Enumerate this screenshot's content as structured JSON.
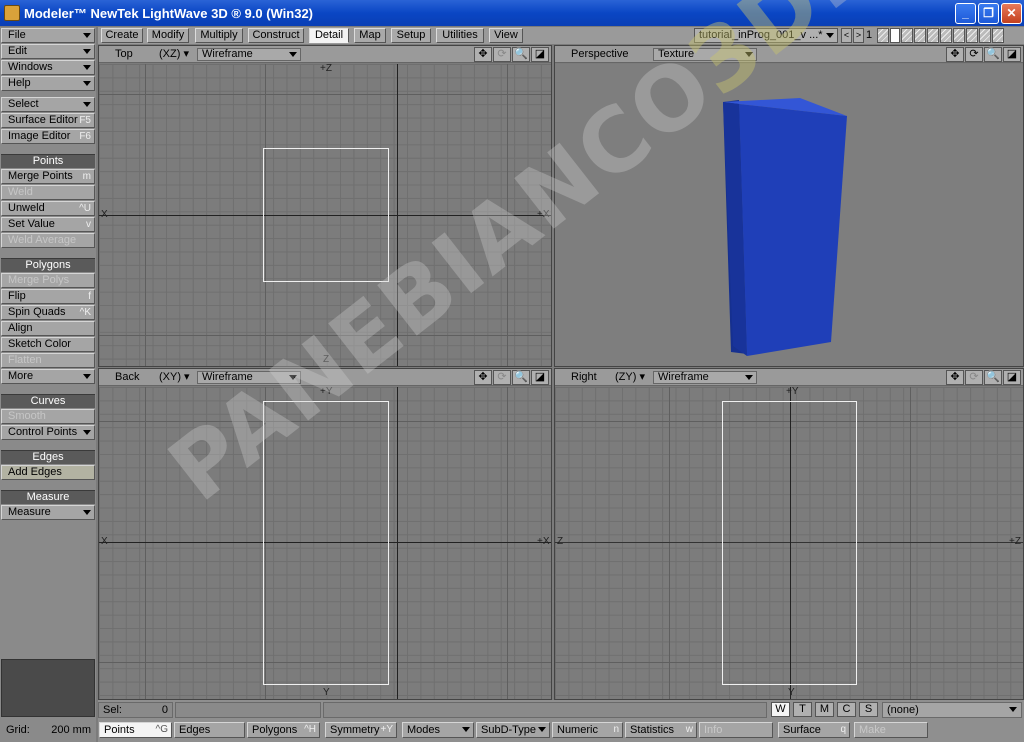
{
  "window": {
    "title": "Modeler™ NewTek LightWave 3D ® 9.0 (Win32)",
    "minimize": "_",
    "maximize": "❐",
    "close": "✕"
  },
  "sidebar": {
    "menus": [
      {
        "label": "File"
      },
      {
        "label": "Edit"
      },
      {
        "label": "Windows"
      },
      {
        "label": "Help"
      }
    ],
    "select": "Select",
    "surface_editor": {
      "label": "Surface Editor",
      "shortcut": "F5"
    },
    "image_editor": {
      "label": "Image Editor",
      "shortcut": "F6"
    },
    "points_header": "Points",
    "points_items": [
      {
        "label": "Merge Points",
        "shortcut": "m"
      },
      {
        "label": "Weld",
        "shortcut": ""
      },
      {
        "label": "Unweld",
        "shortcut": "^U"
      },
      {
        "label": "Set Value",
        "shortcut": "v"
      },
      {
        "label": "Weld Average",
        "shortcut": ""
      }
    ],
    "polygons_header": "Polygons",
    "polygons_items": [
      {
        "label": "Merge Polys",
        "shortcut": ""
      },
      {
        "label": "Flip",
        "shortcut": "f"
      },
      {
        "label": "Spin Quads",
        "shortcut": "^K"
      },
      {
        "label": "Align",
        "shortcut": ""
      },
      {
        "label": "Sketch Color",
        "shortcut": ""
      },
      {
        "label": "Flatten",
        "shortcut": ""
      }
    ],
    "more": "More",
    "curves_header": "Curves",
    "smooth": "Smooth",
    "control_points": "Control Points",
    "edges_header": "Edges",
    "add_edges": "Add Edges",
    "measure_header": "Measure",
    "measure": "Measure",
    "grid_label": "Grid:",
    "grid_value": "200 mm"
  },
  "tabs": [
    "Create",
    "Modify",
    "Multiply",
    "Construct",
    "Detail",
    "Map",
    "Setup",
    "Utilities",
    "View"
  ],
  "active_tab": "Detail",
  "layers": {
    "object": "tutorial_inProg_001_v ...*",
    "prev": "<",
    "next": ">",
    "number": "1"
  },
  "viewports": {
    "top": {
      "view": "Top",
      "axes": "(XZ)",
      "mode": "Wireframe",
      "label_top": "+Z",
      "label_bottom": "Z",
      "label_left": "X",
      "label_right": "+X"
    },
    "perspective": {
      "view": "Perspective",
      "mode": "Texture"
    },
    "back": {
      "view": "Back",
      "axes": "(XY)",
      "mode": "Wireframe",
      "label_top": "+Y",
      "label_bottom": "Y",
      "label_left": "X",
      "label_right": "+X"
    },
    "right": {
      "view": "Right",
      "axes": "(ZY)",
      "mode": "Wireframe",
      "label_top": "+Y",
      "label_bottom": "Y",
      "label_left": "Z",
      "label_right": "+Z"
    }
  },
  "viewport_icons": {
    "move": "✥",
    "rotate": "⟳",
    "zoom": "🔍",
    "maximize": "◪"
  },
  "bottom": {
    "sel_label": "Sel:",
    "sel_value": "0",
    "wtmcs": [
      "W",
      "T",
      "M",
      "C",
      "S"
    ],
    "surface_select": "(none)",
    "points": {
      "label": "Points",
      "shortcut": "^G"
    },
    "edges": {
      "label": "Edges",
      "shortcut": ""
    },
    "polygons": {
      "label": "Polygons",
      "shortcut": "^H"
    },
    "symmetry": {
      "label": "Symmetry",
      "shortcut": "+Y"
    },
    "modes": "Modes",
    "subd_type": "SubD-Type",
    "numeric": {
      "label": "Numeric",
      "shortcut": "n"
    },
    "statistics": {
      "label": "Statistics",
      "shortcut": "w"
    },
    "info": "Info",
    "surface": {
      "label": "Surface",
      "shortcut": "q"
    },
    "make": "Make"
  },
  "watermark": {
    "pre": "PANEBIANCO",
    "mid": "3D",
    "post": ".COM"
  },
  "colors": {
    "cube": "#1f3fb8",
    "active_tab": "#f3f3f3"
  }
}
